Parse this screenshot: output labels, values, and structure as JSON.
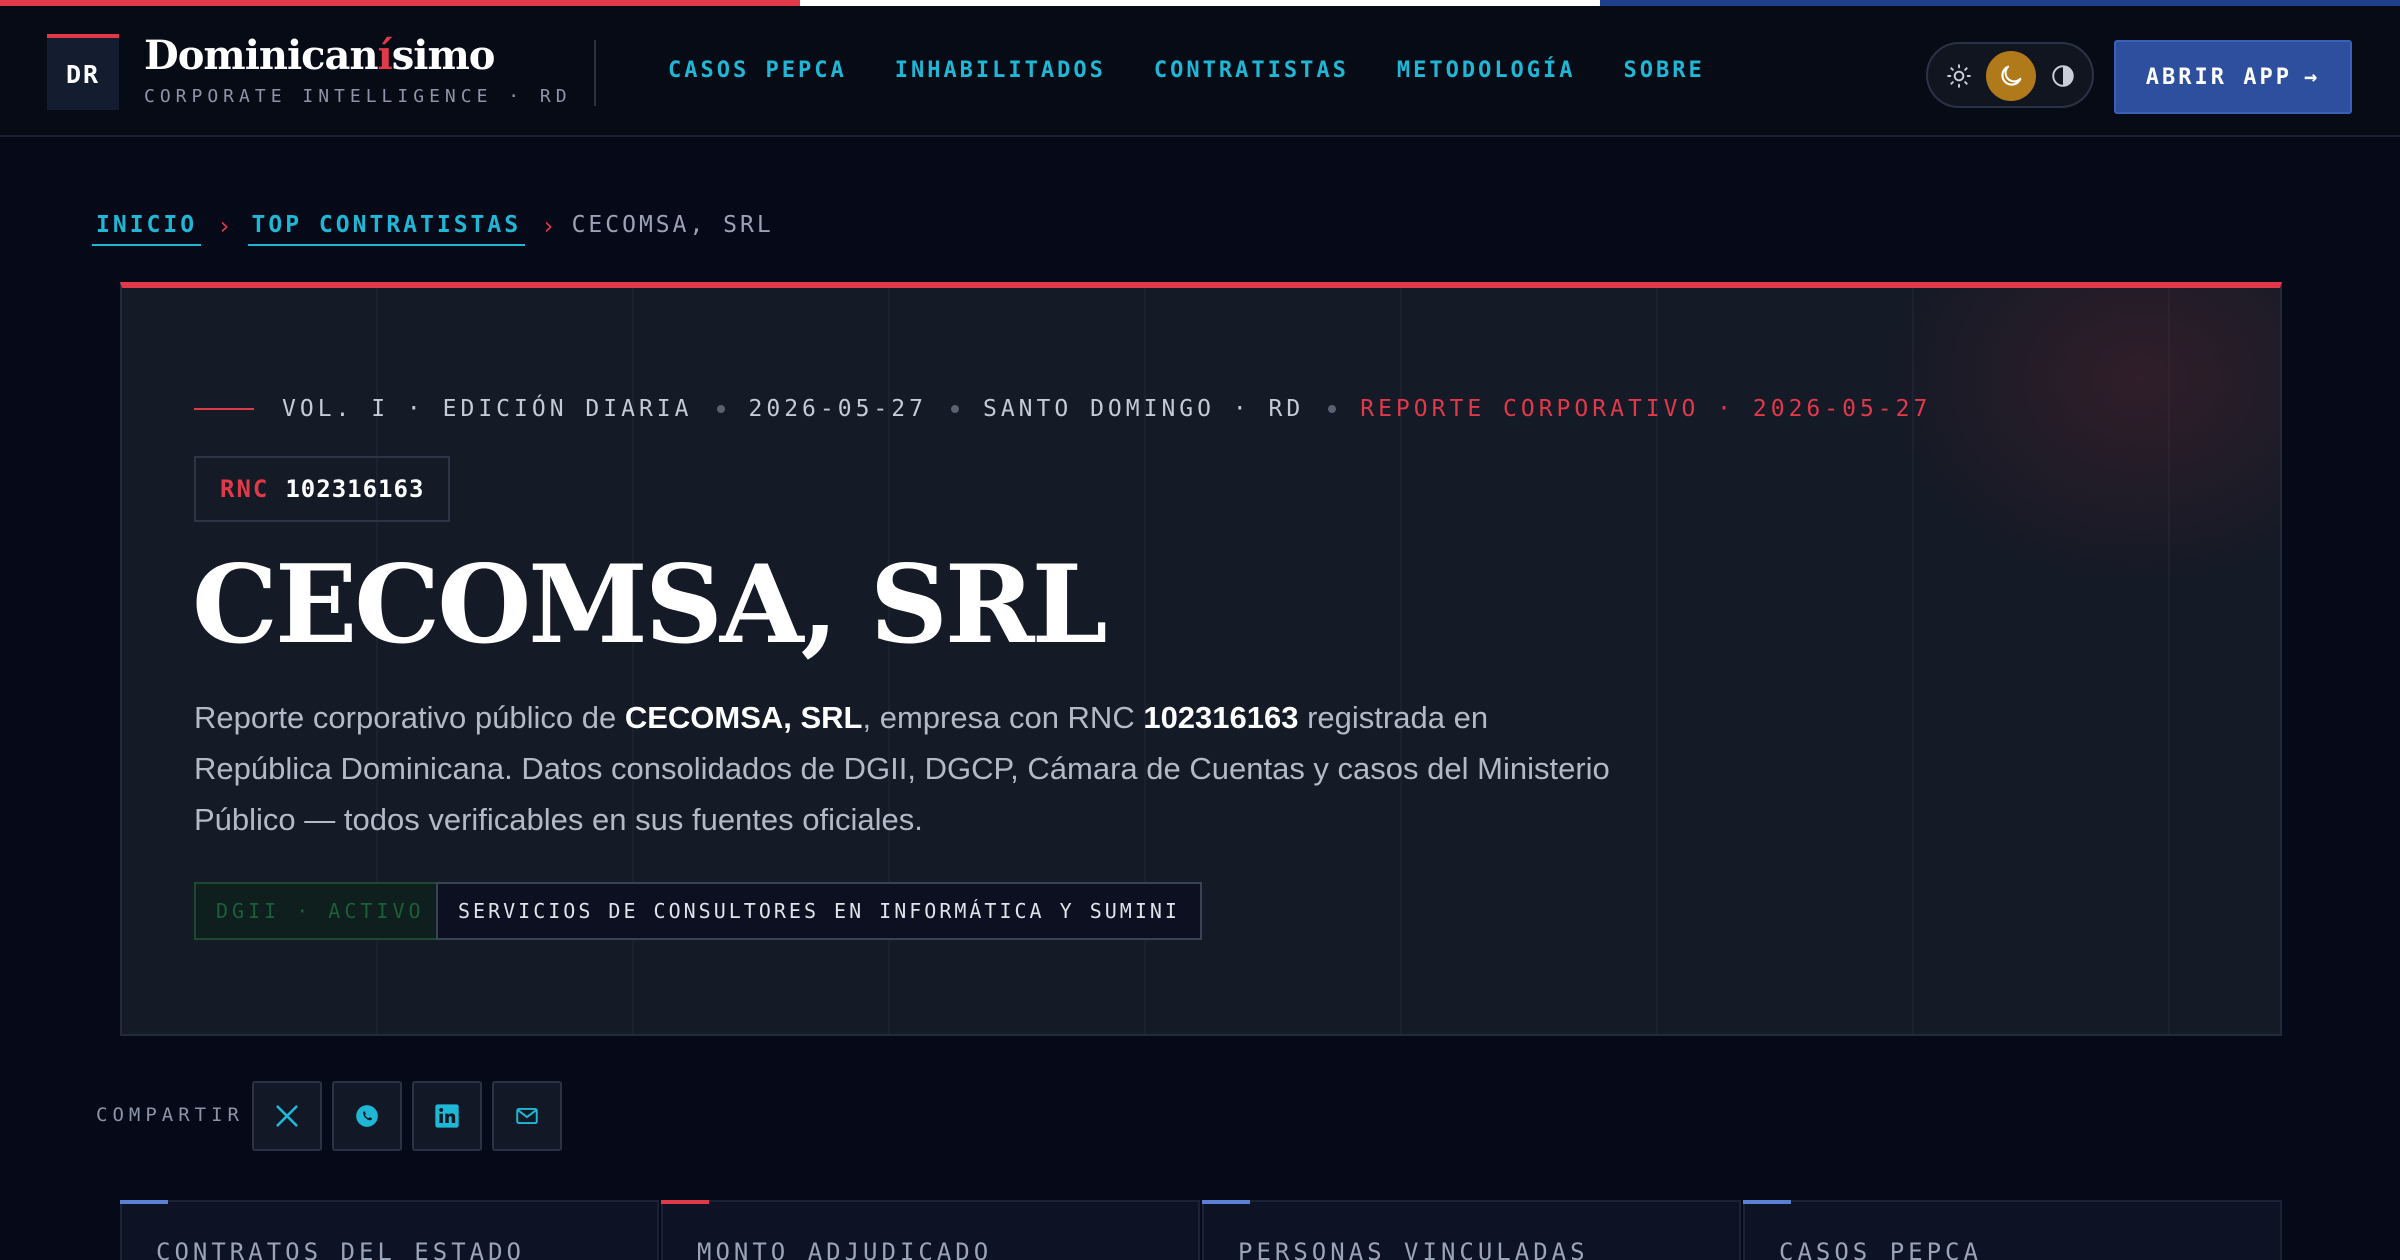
{
  "colors": {
    "flag_red": "#e0394a",
    "flag_white": "#ffffff",
    "flag_blue": "#1e3f8a",
    "accent_cyan": "#1fb7d6",
    "button_blue": "#2d4f9e",
    "stat_accents": [
      "#5b7fd1",
      "#e0394a",
      "#5b7fd1",
      "#5b7fd1"
    ]
  },
  "header": {
    "logo_initials": "DR",
    "brand_pre": "Dominican",
    "brand_mark": "í",
    "brand_post": "simo",
    "brand_sub": "CORPORATE INTELLIGENCE · RD",
    "nav": [
      {
        "label": "CASOS PEPCA"
      },
      {
        "label": "INHABILITADOS"
      },
      {
        "label": "CONTRATISTAS"
      },
      {
        "label": "METODOLOGÍA"
      },
      {
        "label": "SOBRE"
      }
    ],
    "theme_options": [
      "sun-icon",
      "moon-icon",
      "contrast-icon"
    ],
    "theme_active": "moon-icon",
    "cta_label": "ABRIR APP",
    "cta_arrow": "→"
  },
  "breadcrumb": {
    "items": [
      "INICIO",
      "TOP CONTRATISTAS"
    ],
    "separator": "›",
    "current": "CECOMSA, SRL"
  },
  "hero": {
    "meta": {
      "vol": "VOL. I · EDICIÓN DIARIA",
      "date": "2026-05-27",
      "place": "SANTO DOMINGO · RD",
      "report": "REPORTE CORPORATIVO · 2026-05-27"
    },
    "rnc_label": "RNC",
    "rnc_value": "102316163",
    "title": "CECOMSA, SRL",
    "desc": {
      "t1": "Reporte corporativo público de ",
      "b1": "CECOMSA, SRL",
      "t2": ", empresa con RNC ",
      "b2": "102316163",
      "t3": " registrada en República Dominicana. Datos consolidados de DGII, DGCP, Cámara de Cuentas y casos del Ministerio Público — todos verificables en sus fuentes oficiales."
    },
    "status_chip": "DGII · ACTIVO",
    "sector_chip": "SERVICIOS DE CONSULTORES EN INFORMÁTICA Y SUMINI"
  },
  "share": {
    "label": "COMPARTIR",
    "buttons": [
      "x-icon",
      "whatsapp-icon",
      "linkedin-icon",
      "mail-icon"
    ]
  },
  "stats": [
    {
      "label": "CONTRATOS DEL ESTADO"
    },
    {
      "label": "MONTO ADJUDICADO"
    },
    {
      "label": "PERSONAS VINCULADAS"
    },
    {
      "label": "CASOS PEPCA"
    }
  ]
}
